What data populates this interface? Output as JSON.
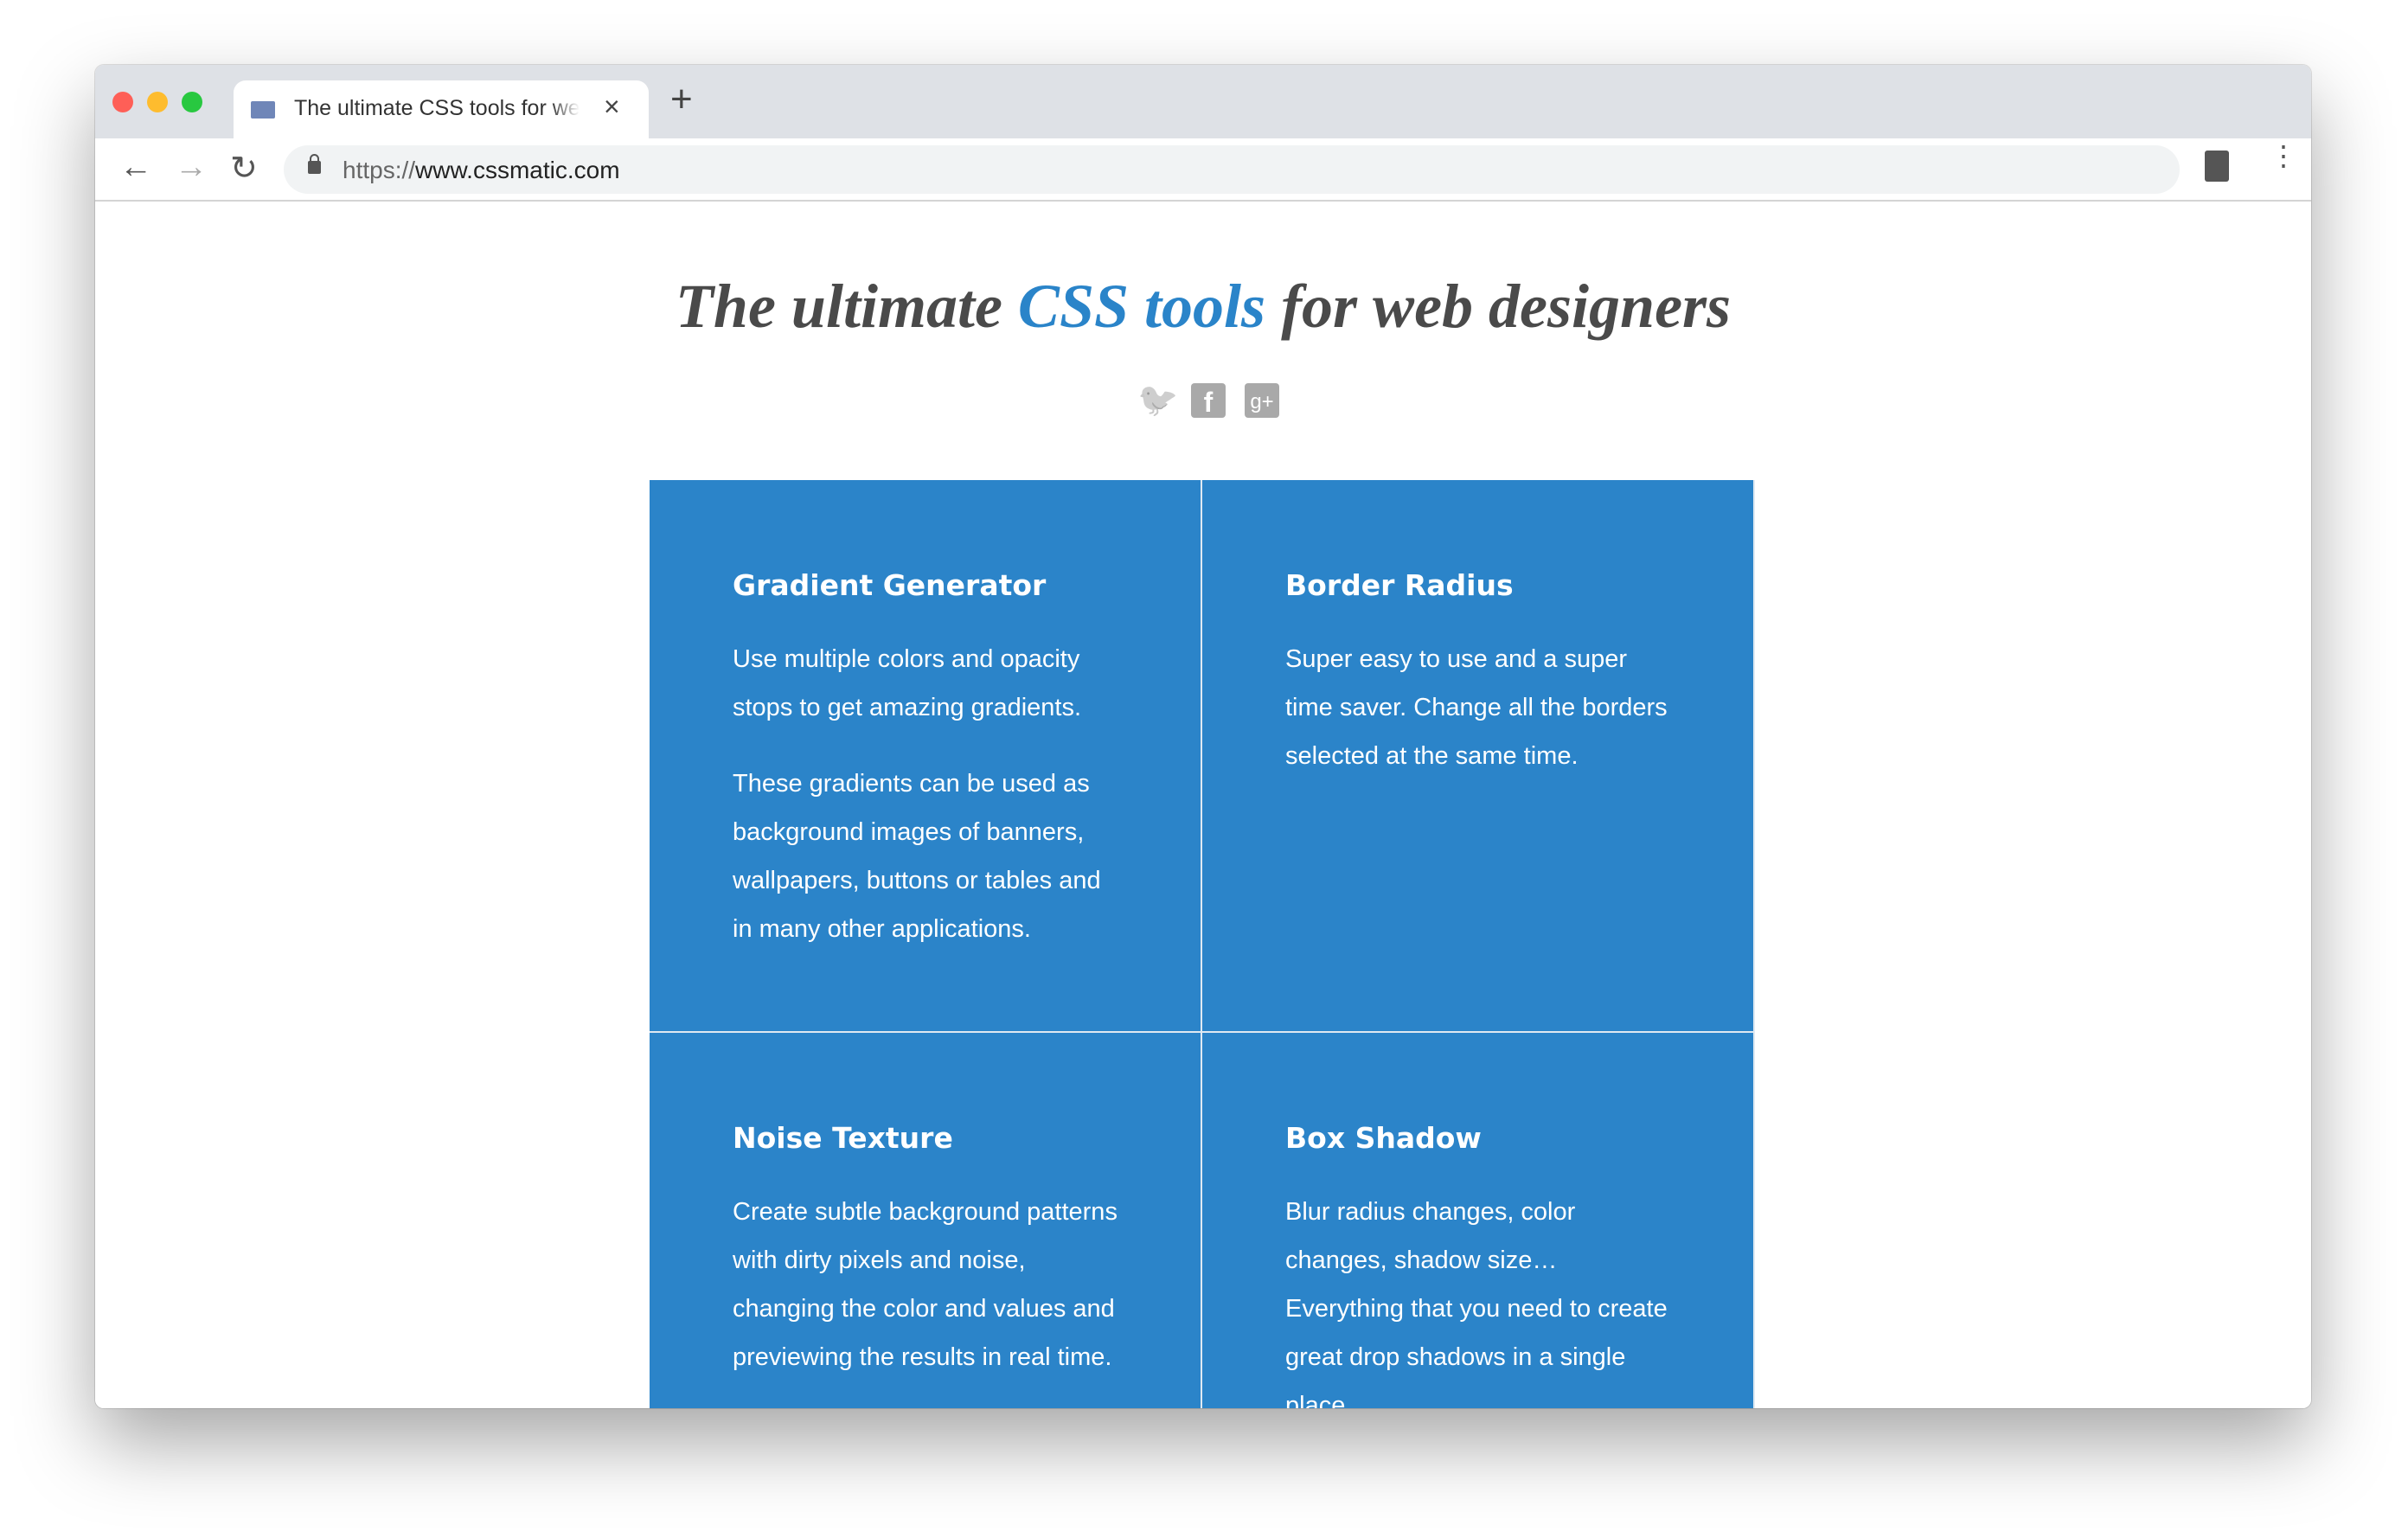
{
  "browser": {
    "tab_title": "The ultimate CSS tools for web designers",
    "url_scheme": "https://",
    "url_host": "www.cssmatic.com",
    "new_tab": "+",
    "close": "×",
    "back": "←",
    "forward": "→",
    "reload": "↻",
    "menu": "⋮"
  },
  "header": {
    "title_pre": "The ultimate ",
    "title_accent": "CSS tools",
    "title_post": " for web designers",
    "accent_color": "#2a84c9"
  },
  "social": [
    {
      "icon": "twitter-icon",
      "glyph": "🐦"
    },
    {
      "icon": "facebook-icon",
      "glyph": "f"
    },
    {
      "icon": "google-plus-icon",
      "glyph": "g+"
    }
  ],
  "cards": [
    {
      "title": "Gradient Generator",
      "paragraphs": [
        "Use multiple colors and opacity stops to get amazing gradients.",
        "These gradients can be used as background images of banners, wallpapers, buttons or tables and in many other applications."
      ]
    },
    {
      "title": "Border Radius",
      "paragraphs": [
        "Super easy to use and a super time saver. Change all the borders selected at the same time."
      ]
    },
    {
      "title": "Noise Texture",
      "paragraphs": [
        "Create subtle background patterns with dirty pixels and noise, changing the color and values and previewing the results in real time."
      ]
    },
    {
      "title": "Box Shadow",
      "paragraphs": [
        "Blur radius changes, color changes, shadow size… Everything that you need to create great drop shadows in a single place."
      ]
    }
  ],
  "card_color": "#2b84c9"
}
